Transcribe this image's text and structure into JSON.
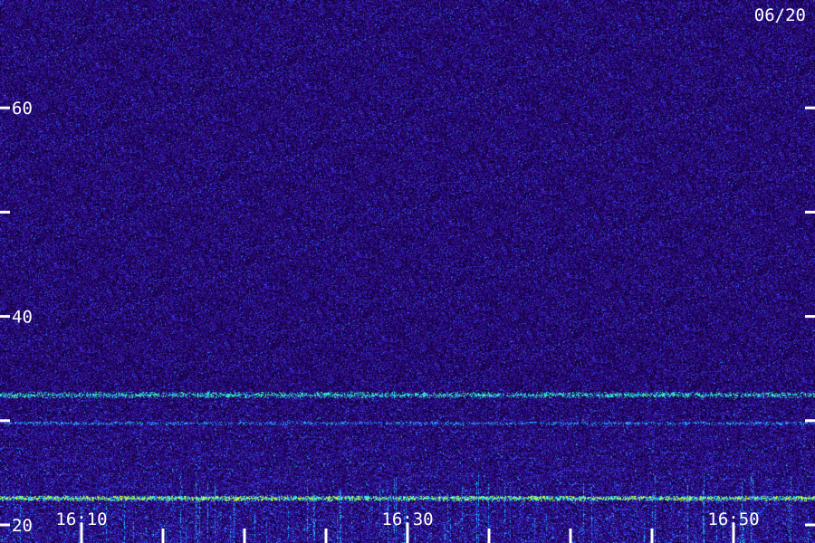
{
  "chart_data": {
    "type": "heatmap",
    "date_label": "06/20",
    "y_axis": {
      "range": [
        20,
        70
      ],
      "major_ticks": [
        20,
        30,
        40,
        50,
        60
      ],
      "labeled_ticks": [
        {
          "value": 20,
          "label": "20"
        },
        {
          "value": 40,
          "label": "40"
        },
        {
          "value": 60,
          "label": "60"
        }
      ]
    },
    "x_axis": {
      "range": [
        "16:05",
        "16:55"
      ],
      "minor_tick_interval_min": 5,
      "labeled_ticks": [
        {
          "time": "16:10",
          "label": "16:10"
        },
        {
          "time": "16:30",
          "label": "16:30"
        },
        {
          "time": "16:50",
          "label": "16:50"
        }
      ]
    },
    "bands": [
      {
        "y_value": 22.6,
        "intensity": "high",
        "color": "#c8ff3a"
      },
      {
        "y_value": 32.5,
        "intensity": "medium",
        "color": "#3cff9a"
      },
      {
        "y_value": 29.8,
        "intensity": "low",
        "color": "#2a6cff"
      }
    ],
    "colormap": [
      "#12003a",
      "#2a0a7a",
      "#3a20c8",
      "#2a6cff",
      "#1ad0ff",
      "#3cff9a",
      "#c8ff3a"
    ],
    "grid": false
  }
}
